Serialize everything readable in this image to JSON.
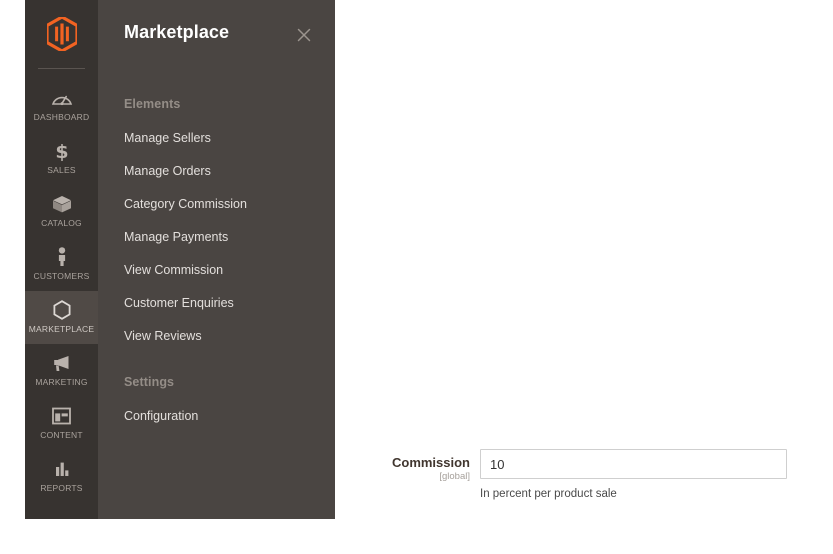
{
  "colors": {
    "brand_orange": "#f26322",
    "rail_bg": "#373330",
    "rail_active_bg": "#504a46",
    "flyout_bg": "#4a4542",
    "label_text": "#41362f",
    "input_border": "#cfcfcf"
  },
  "sidebar": {
    "logo_name": "magento-logo",
    "items": [
      {
        "label": "DASHBOARD",
        "icon": "dashboard-gauge-icon",
        "active": false
      },
      {
        "label": "SALES",
        "icon": "dollar-sign-icon",
        "active": false
      },
      {
        "label": "CATALOG",
        "icon": "box-icon",
        "active": false
      },
      {
        "label": "CUSTOMERS",
        "icon": "person-icon",
        "active": false
      },
      {
        "label": "MARKETPLACE",
        "icon": "hexagon-icon",
        "active": true
      },
      {
        "label": "MARKETING",
        "icon": "megaphone-icon",
        "active": false
      },
      {
        "label": "CONTENT",
        "icon": "page-layout-icon",
        "active": false
      },
      {
        "label": "REPORTS",
        "icon": "bar-chart-icon",
        "active": false
      }
    ]
  },
  "flyout": {
    "title": "Marketplace",
    "close_icon": "close-icon",
    "sections": [
      {
        "title": "Elements",
        "items": [
          "Manage Sellers",
          "Manage Orders",
          "Category Commission",
          "Manage Payments",
          "View Commission",
          "Customer Enquiries",
          "View Reviews"
        ]
      },
      {
        "title": "Settings",
        "items": [
          "Configuration"
        ]
      }
    ]
  },
  "form": {
    "commission": {
      "label": "Commission",
      "scope": "[global]",
      "value": "10",
      "placeholder": "",
      "note": "In percent per product sale"
    }
  }
}
